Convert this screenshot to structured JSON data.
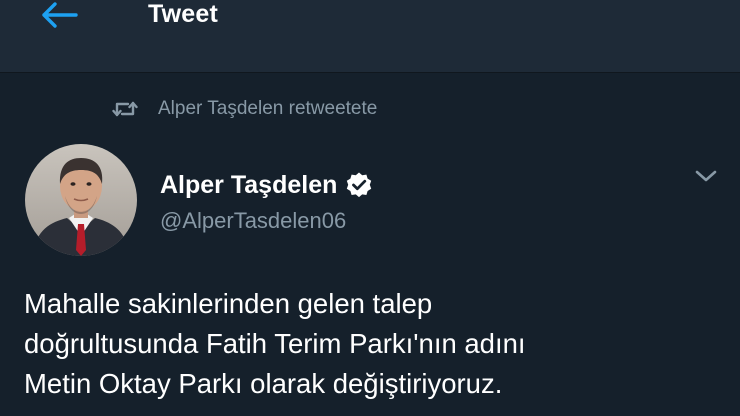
{
  "header": {
    "back_icon": "arrow-left-icon",
    "title": "Tweet"
  },
  "retweet": {
    "icon": "retweet-icon",
    "text": "Alper Taşdelen retweetete"
  },
  "author": {
    "name": "Alper Taşdelen",
    "handle": "@AlperTasdelen06",
    "verified": true
  },
  "tweet": {
    "text": "Mahalle sakinlerinden gelen talep\ndoğrultusunda Fatih Terim Parkı'nın adını\nMetin Oktay Parkı olarak değiştiriyoruz."
  },
  "colors": {
    "background": "#15202b",
    "header_background": "#1e2a37",
    "accent": "#1da1f2",
    "secondary_text": "#8899a6"
  }
}
